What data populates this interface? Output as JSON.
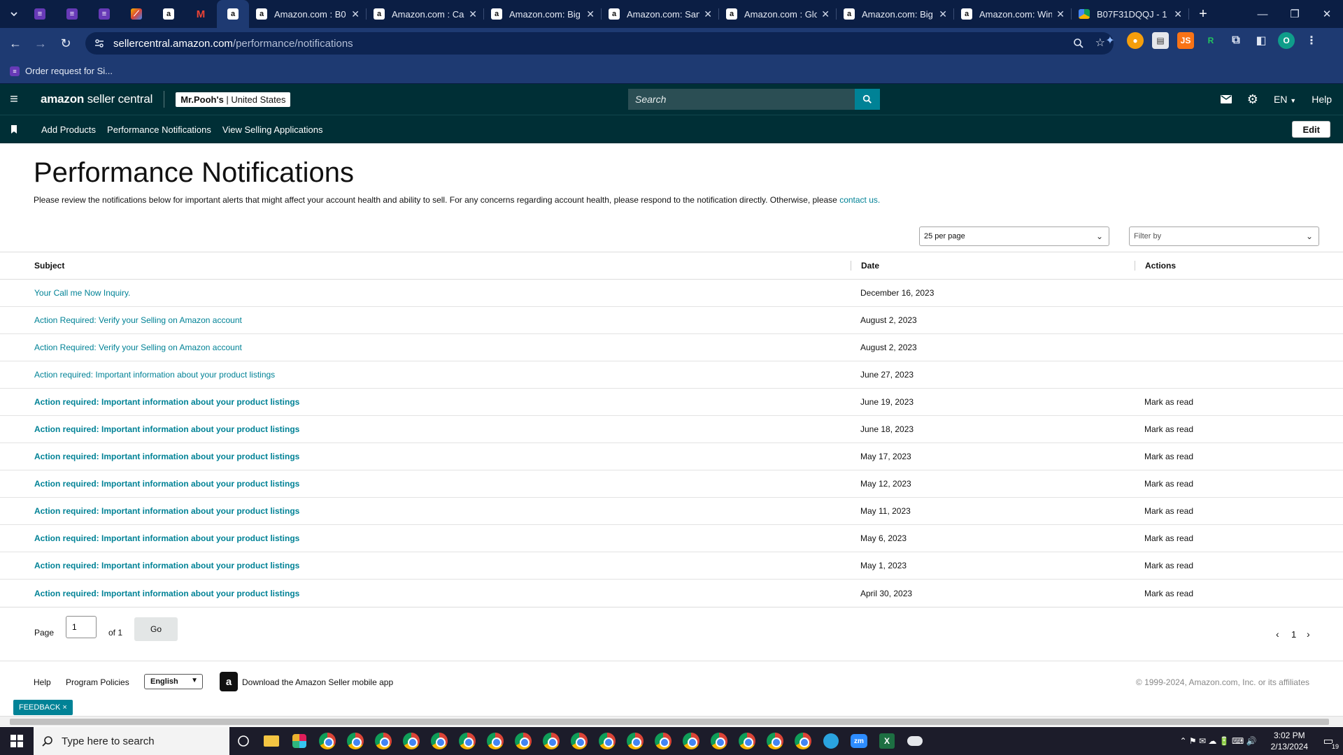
{
  "browser": {
    "tabs": [
      {
        "title": "Amazon.com : B0"
      },
      {
        "title": "Amazon.com : Ca"
      },
      {
        "title": "Amazon.com: Big"
      },
      {
        "title": "Amazon.com: San"
      },
      {
        "title": "Amazon.com : Glo"
      },
      {
        "title": "Amazon.com: Big"
      },
      {
        "title": "Amazon.com: Win"
      },
      {
        "title": "B07F31DQQJ - 1"
      }
    ],
    "url_domain": "sellercentral.amazon.com",
    "url_path": "/performance/notifications",
    "bookmark": "Order request for Si...",
    "profile_initial": "O"
  },
  "header": {
    "logo_brand": "amazon",
    "logo_rest": "seller central",
    "store_name": "Mr.Pooh's",
    "store_region": "United States",
    "search_placeholder": "Search",
    "language": "EN",
    "help": "Help"
  },
  "nav": {
    "links": [
      "Add Products",
      "Performance Notifications",
      "View Selling Applications"
    ],
    "edit": "Edit"
  },
  "page": {
    "title": "Performance Notifications",
    "intro": "Please review the notifications below for important alerts that might affect your account health and ability to sell. For any concerns regarding account health, please respond to the notification directly. Otherwise, please",
    "intro_link": "contact us.",
    "per_page": "25 per page",
    "filter_placeholder": "Filter by"
  },
  "table": {
    "headers": {
      "subject": "Subject",
      "date": "Date",
      "actions": "Actions"
    },
    "rows": [
      {
        "subject": "Your Call me Now Inquiry.",
        "date": "December 16, 2023",
        "action": "",
        "unread": false
      },
      {
        "subject": "Action Required: Verify your Selling on Amazon account",
        "date": "August 2, 2023",
        "action": "",
        "unread": false
      },
      {
        "subject": "Action Required: Verify your Selling on Amazon account",
        "date": "August 2, 2023",
        "action": "",
        "unread": false
      },
      {
        "subject": "Action required: Important information about your product listings",
        "date": "June 27, 2023",
        "action": "",
        "unread": false
      },
      {
        "subject": "Action required: Important information about your product listings",
        "date": "June 19, 2023",
        "action": "Mark as read",
        "unread": true
      },
      {
        "subject": "Action required: Important information about your product listings",
        "date": "June 18, 2023",
        "action": "Mark as read",
        "unread": true
      },
      {
        "subject": "Action required: Important information about your product listings",
        "date": "May 17, 2023",
        "action": "Mark as read",
        "unread": true
      },
      {
        "subject": "Action required: Important information about your product listings",
        "date": "May 12, 2023",
        "action": "Mark as read",
        "unread": true
      },
      {
        "subject": "Action required: Important information about your product listings",
        "date": "May 11, 2023",
        "action": "Mark as read",
        "unread": true
      },
      {
        "subject": "Action required: Important information about your product listings",
        "date": "May 6, 2023",
        "action": "Mark as read",
        "unread": true
      },
      {
        "subject": "Action required: Important information about your product listings",
        "date": "May 1, 2023",
        "action": "Mark as read",
        "unread": true
      },
      {
        "subject": "Action required: Important information about your product listings",
        "date": "April 30, 2023",
        "action": "Mark as read",
        "unread": true
      }
    ]
  },
  "pager": {
    "page_label": "Page",
    "page_value": "1",
    "of_label": "of 1",
    "go": "Go",
    "current": "1"
  },
  "footer": {
    "help": "Help",
    "policies": "Program Policies",
    "language": "English",
    "app_text": "Download the Amazon Seller mobile app",
    "copyright": "© 1999-2024, Amazon.com, Inc. or its affiliates"
  },
  "feedback": "FEEDBACK ×",
  "taskbar": {
    "search_placeholder": "Type here to search",
    "time": "3:02 PM",
    "date": "2/13/2024",
    "notifications": "19"
  },
  "colors": {
    "sc_header": "#002f36",
    "link": "#008296",
    "browser_dark": "#0b1e44",
    "browser_toolbar": "#1e3a72"
  }
}
